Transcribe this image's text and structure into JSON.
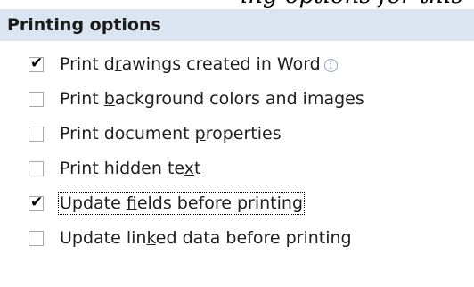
{
  "clipped_heading": "ing options for this",
  "section": {
    "title": "Printing options"
  },
  "options": [
    {
      "text_before": "Print d",
      "accelerator": "r",
      "text_after": "awings created in Word",
      "checked": true,
      "has_info_icon": true
    },
    {
      "text_before": "Print ",
      "accelerator": "b",
      "text_after": "ackground colors and images",
      "checked": false
    },
    {
      "text_before": "Print document ",
      "accelerator": "p",
      "text_after": "roperties",
      "checked": false
    },
    {
      "text_before": "Print hidden te",
      "accelerator": "x",
      "text_after": "t",
      "checked": false
    },
    {
      "text_before": "Update ",
      "accelerator": "f",
      "text_after": "ields before printing",
      "checked": true,
      "focused": true
    },
    {
      "text_before": "Update lin",
      "accelerator": "k",
      "text_after": "ed data before printing",
      "checked": false
    }
  ],
  "icons": {
    "info": "info-icon",
    "checkmark": "✔"
  }
}
